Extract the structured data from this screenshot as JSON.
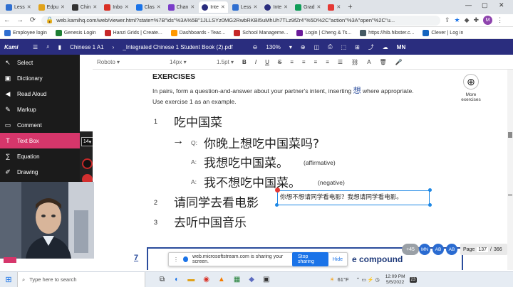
{
  "tabs": [
    {
      "label": "Less",
      "color": "#2f6fd1"
    },
    {
      "label": "Edpu",
      "color": "#e0a21a"
    },
    {
      "label": "Chin",
      "color": "#333333"
    },
    {
      "label": "Inbo",
      "color": "#d93025"
    },
    {
      "label": "Clas",
      "color": "#1a73e8"
    },
    {
      "label": "Chan",
      "color": "#7a3cc9"
    },
    {
      "label": "Inte",
      "color": "#2a2d7e",
      "active": true
    },
    {
      "label": "Less",
      "color": "#2f6fd1"
    },
    {
      "label": "Inte",
      "color": "#2a2d7e"
    },
    {
      "label": "Grad",
      "color": "#0f9d58"
    },
    {
      "label": "",
      "color": "#e53935"
    }
  ],
  "address": {
    "url": "web.kamihq.com/web/viewer.html?state=%7B\"ids\"%3A%5B\"1JLLSYz0MG2RwbRKBI5uMhUh7TLz9fZr4\"%5D%2C\"action\"%3A\"open\"%2C\"u..."
  },
  "bookmarks": [
    "Employee login",
    "Genesis Login",
    "Hanzi Grids | Create...",
    "Dashboards - Teac...",
    "School Manageme...",
    "Login | Cheng & Ts...",
    "https://hib.hibster.c...",
    "Clever | Log in"
  ],
  "kami": {
    "brand": "Kami",
    "doc1": "Chinese 1 A1",
    "doc2": "_Integrated Chinese 1 Student Book (2).pdf",
    "zoom": "130%",
    "user": "MN"
  },
  "format": {
    "font": "Roboto",
    "size": "14px",
    "spacing": "1.5pt"
  },
  "sidebar": [
    {
      "label": "Select",
      "icon": "cursor-icon"
    },
    {
      "label": "Dictionary",
      "icon": "dictionary-icon"
    },
    {
      "label": "Read Aloud",
      "icon": "speaker-icon"
    },
    {
      "label": "Markup",
      "icon": "markup-icon"
    },
    {
      "label": "Comment",
      "icon": "comment-icon"
    },
    {
      "label": "Text Box",
      "icon": "textbox-icon",
      "active": true
    },
    {
      "label": "Equation",
      "icon": "equation-icon"
    },
    {
      "label": "Drawing",
      "icon": "drawing-icon"
    }
  ],
  "textbox_size": "14",
  "doc": {
    "heading": "EXERCISES",
    "instruction_a": "In pairs, form a question-and-answer about your partner's intent, inserting",
    "instruction_char": "想",
    "instruction_b": "where appropriate.",
    "instruction_c": "Use exercise 1 as an example.",
    "more_label_1": "More",
    "more_label_2": "exercises",
    "n1": "1",
    "item1": "吃中国菜",
    "arrow": "→",
    "q": "Q:",
    "qtext": "你晚上想吃中国菜吗?",
    "a": "A:",
    "a1": "我想吃中国菜。",
    "a1note": "(affirmative)",
    "a2": "我不想吃中国菜。",
    "a2note": "(negative)",
    "n2": "2",
    "item2": "请同学去看电影",
    "answer": "你想不想请同学看电影？我想请同学看电影。",
    "n3": "3",
    "item3": "去听中国音乐",
    "n7": "7",
    "compound": "e compound"
  },
  "share": {
    "text": "web.microsoftstream.com is sharing your screen.",
    "stop": "Stop sharing",
    "hide": "Hide"
  },
  "pager": {
    "plus": "+45",
    "u1": "MN",
    "u2": "AB",
    "u3": "AB",
    "label": "Page",
    "current": "137",
    "sep": "/",
    "total": "366"
  },
  "taskbar": {
    "search": "Type here to search",
    "temp": "61°F",
    "time": "12:09 PM",
    "date": "5/5/2022",
    "badge": "23"
  },
  "colors": {
    "kami": "#2a2d7e",
    "accent": "#d6366b",
    "primary_blue": "#1a73e8"
  }
}
